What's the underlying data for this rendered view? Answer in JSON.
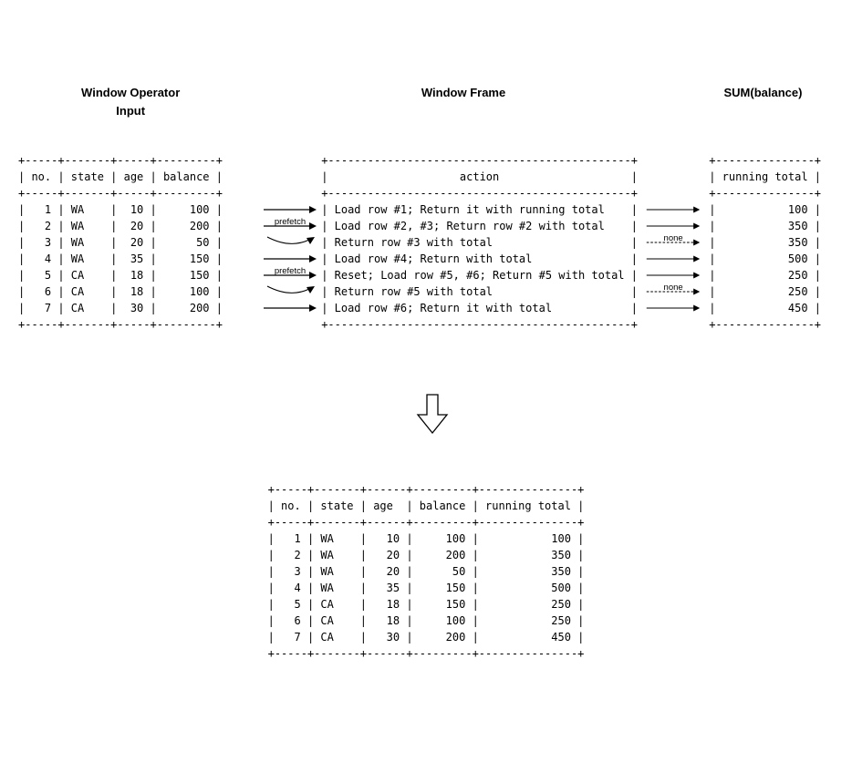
{
  "titles": {
    "left": "Window Operator\nInput",
    "mid": "Window Frame",
    "right": "SUM(balance)"
  },
  "input_table": {
    "header": [
      "no.",
      "state",
      "age",
      "balance"
    ],
    "rows": [
      {
        "no": "1",
        "state": "WA",
        "age": "10",
        "balance": "100"
      },
      {
        "no": "2",
        "state": "WA",
        "age": "20",
        "balance": "200"
      },
      {
        "no": "3",
        "state": "WA",
        "age": "20",
        "balance": "50"
      },
      {
        "no": "4",
        "state": "WA",
        "age": "35",
        "balance": "150"
      },
      {
        "no": "5",
        "state": "CA",
        "age": "18",
        "balance": "150"
      },
      {
        "no": "6",
        "state": "CA",
        "age": "18",
        "balance": "100"
      },
      {
        "no": "7",
        "state": "CA",
        "age": "30",
        "balance": "200"
      }
    ]
  },
  "frame_table": {
    "header": "action",
    "rows": [
      "Load row #1; Return it with running total",
      "Load row #2, #3; Return row #2 with total",
      "Return row #3 with total",
      "Load row #4; Return with total",
      "Reset; Load row #5, #6; Return #5 with total",
      "Return row #5 with total",
      "Load row #6; Return it with total"
    ]
  },
  "sum_table": {
    "header": "running total",
    "rows": [
      "100",
      "350",
      "350",
      "500",
      "250",
      "250",
      "450"
    ]
  },
  "arrows_left": [
    {
      "style": "solid",
      "label": ""
    },
    {
      "style": "solid",
      "label": "prefetch"
    },
    {
      "style": "curve",
      "label": ""
    },
    {
      "style": "solid",
      "label": ""
    },
    {
      "style": "solid",
      "label": "prefetch"
    },
    {
      "style": "curve",
      "label": ""
    },
    {
      "style": "solid",
      "label": ""
    }
  ],
  "arrows_right": [
    {
      "style": "solid",
      "label": ""
    },
    {
      "style": "solid",
      "label": ""
    },
    {
      "style": "dashed",
      "label": "none"
    },
    {
      "style": "solid",
      "label": ""
    },
    {
      "style": "solid",
      "label": ""
    },
    {
      "style": "dashed",
      "label": "none"
    },
    {
      "style": "solid",
      "label": ""
    }
  ],
  "result_table": {
    "header": [
      "no.",
      "state",
      "age",
      "balance",
      "running total"
    ],
    "rows": [
      {
        "no": "1",
        "state": "WA",
        "age": "10",
        "balance": "100",
        "rt": "100"
      },
      {
        "no": "2",
        "state": "WA",
        "age": "20",
        "balance": "200",
        "rt": "350"
      },
      {
        "no": "3",
        "state": "WA",
        "age": "20",
        "balance": "50",
        "rt": "350"
      },
      {
        "no": "4",
        "state": "WA",
        "age": "35",
        "balance": "150",
        "rt": "500"
      },
      {
        "no": "5",
        "state": "CA",
        "age": "18",
        "balance": "150",
        "rt": "250"
      },
      {
        "no": "6",
        "state": "CA",
        "age": "18",
        "balance": "100",
        "rt": "250"
      },
      {
        "no": "7",
        "state": "CA",
        "age": "30",
        "balance": "200",
        "rt": "450"
      }
    ]
  }
}
